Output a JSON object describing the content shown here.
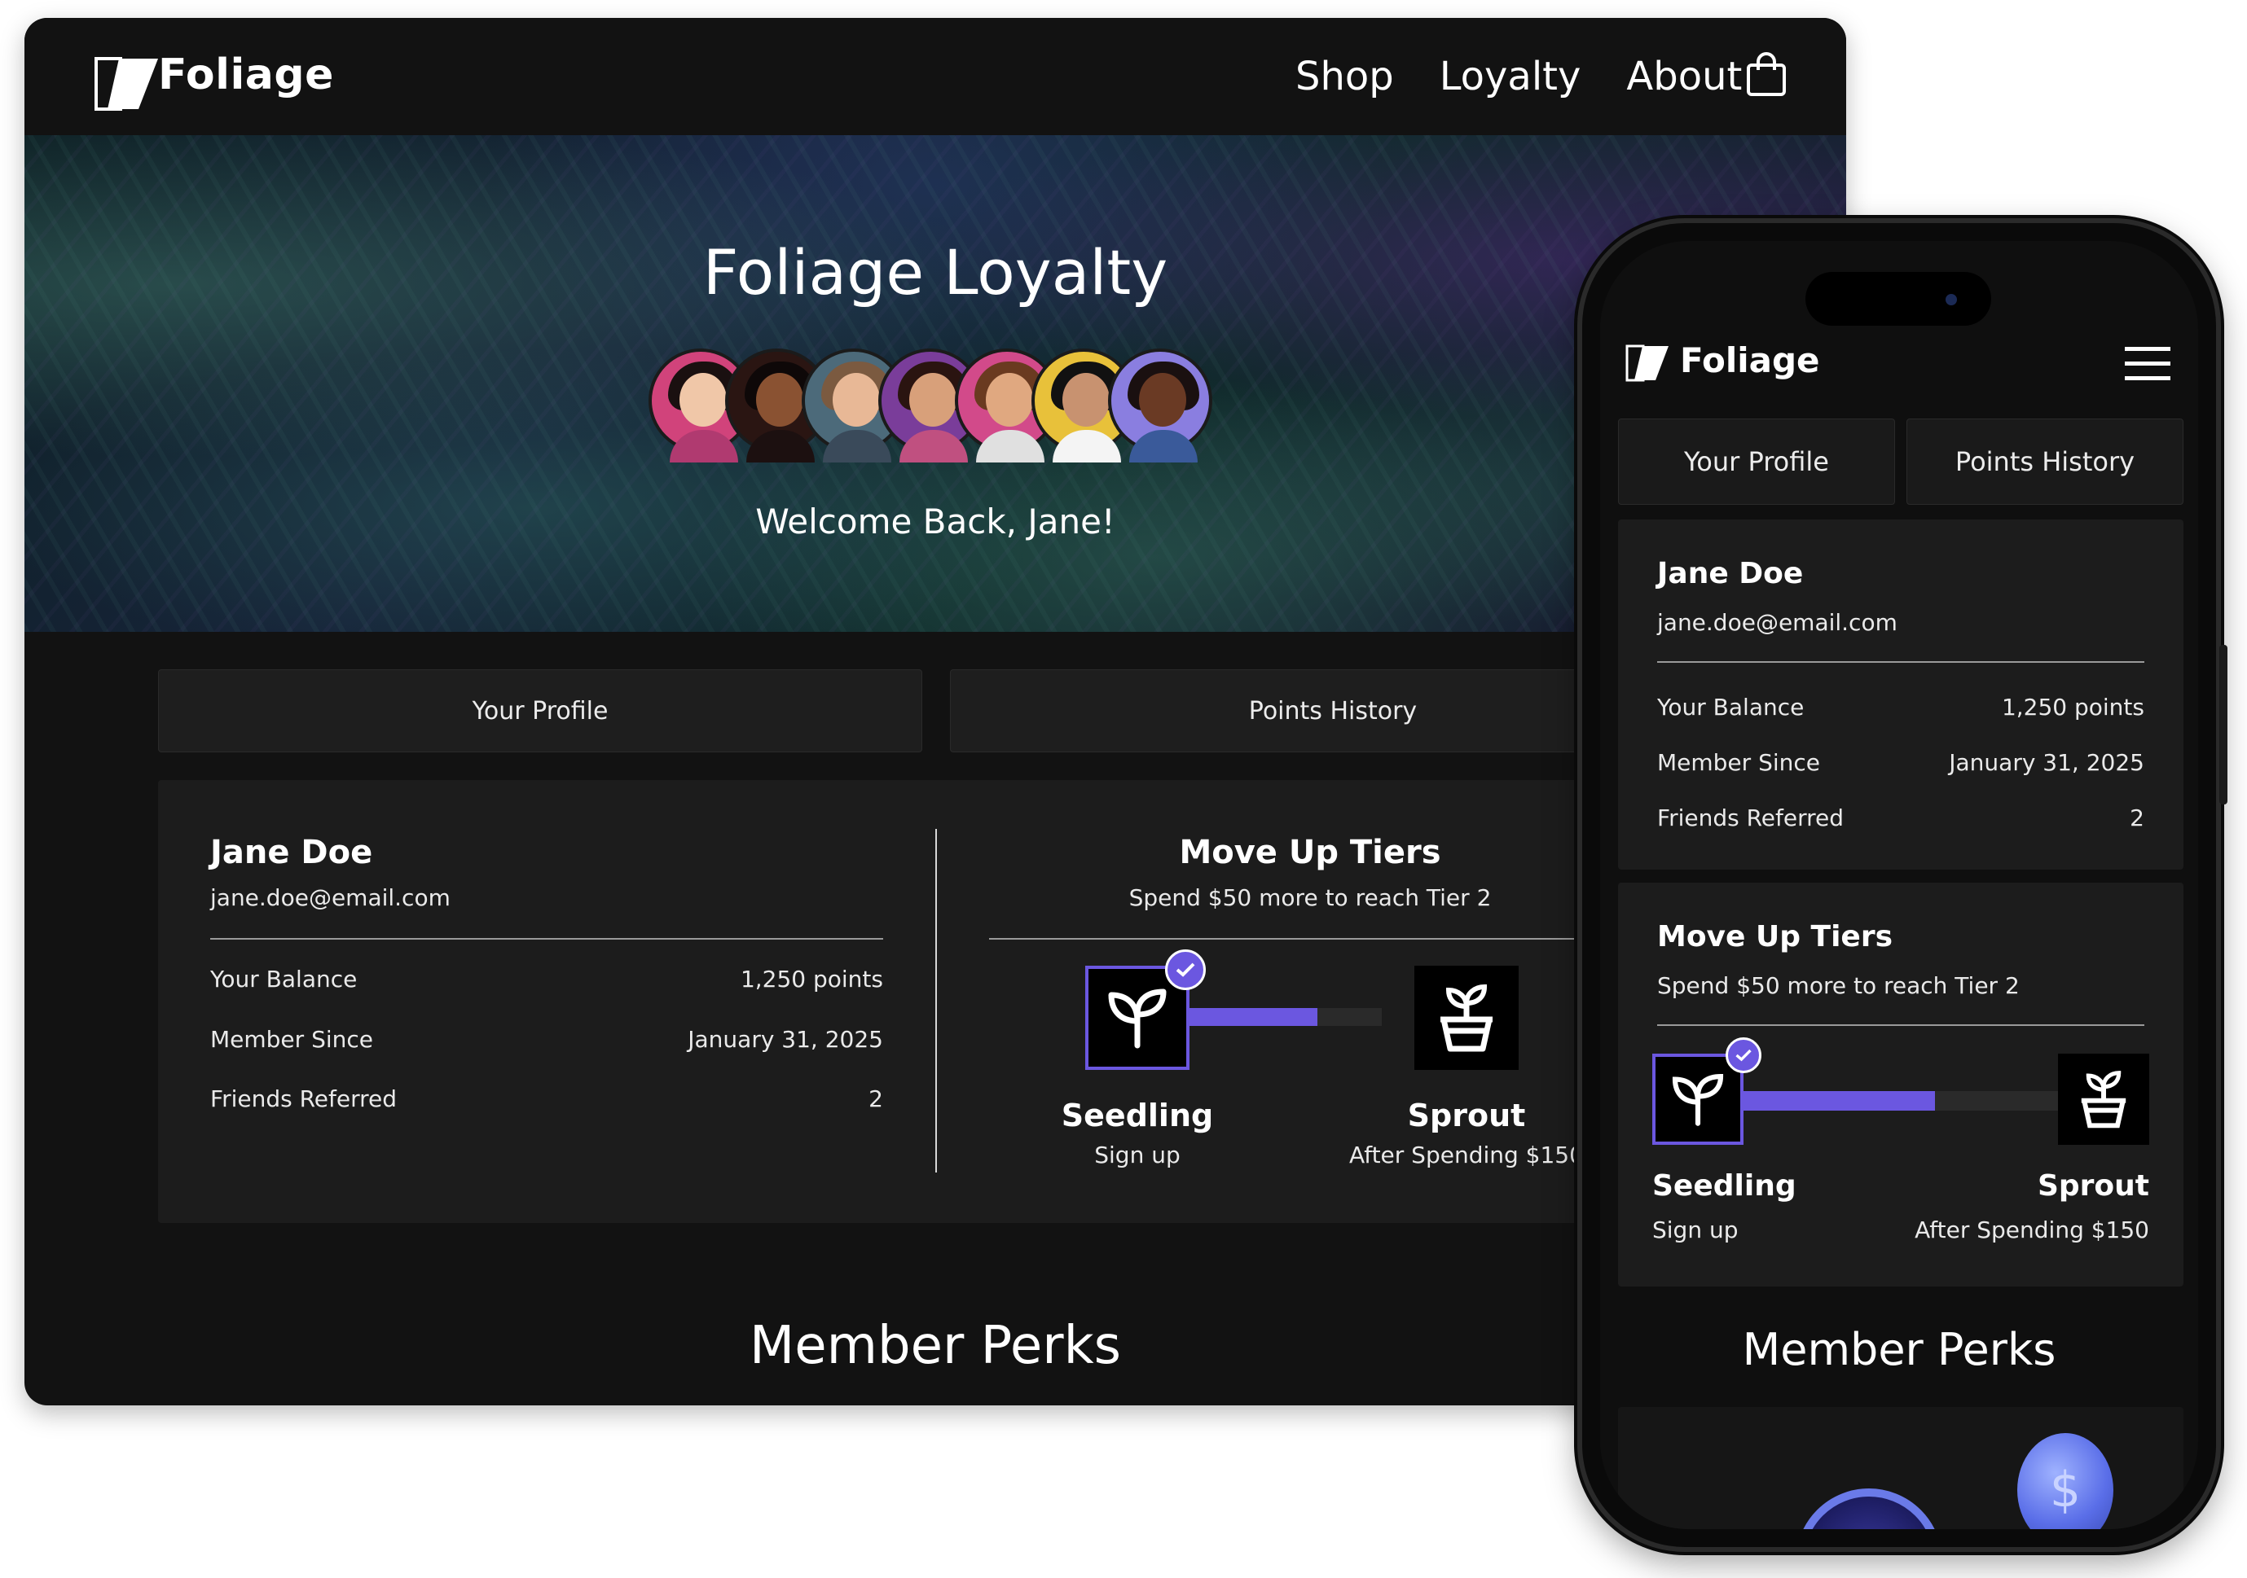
{
  "brand": "Foliage",
  "nav": {
    "links": [
      "Shop",
      "Loyalty",
      "About"
    ],
    "cart_icon": "shopping-bag-icon"
  },
  "hero": {
    "title": "Foliage Loyalty",
    "welcome": "Welcome Back, Jane!"
  },
  "tabs": {
    "profile": "Your Profile",
    "history": "Points History"
  },
  "profile": {
    "name": "Jane Doe",
    "email": "jane.doe@email.com",
    "rows": [
      {
        "label": "Your Balance",
        "value": "1,250 points"
      },
      {
        "label": "Member Since",
        "value": "January 31, 2025"
      },
      {
        "label": "Friends Referred",
        "value": "2"
      }
    ]
  },
  "tiers": {
    "title": "Move Up Tiers",
    "subtitle": "Spend $50 more to reach Tier 2",
    "progress": 0.67,
    "current": {
      "name": "Seedling",
      "desc": "Sign up",
      "icon": "sprout-icon",
      "completed": true
    },
    "next": {
      "name": "Sprout",
      "desc": "After Spending $150",
      "icon": "potted-plant-icon"
    }
  },
  "perks": {
    "title": "Member Perks"
  },
  "colors": {
    "accent": "#6b57e0",
    "background": "#121212",
    "card": "#1c1c1c"
  },
  "phone": {
    "menu_icon": "hamburger-menu-icon"
  }
}
